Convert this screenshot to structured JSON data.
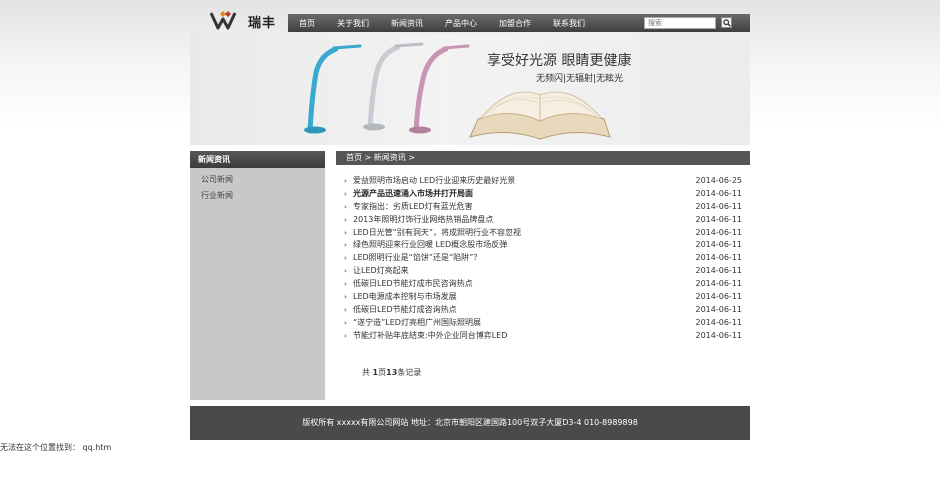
{
  "header": {
    "logo_text": "瑞丰",
    "nav": [
      "首页",
      "关于我们",
      "新闻资讯",
      "产品中心",
      "加盟合作",
      "联系我们"
    ],
    "search_placeholder": "搜索"
  },
  "banner": {
    "title": "享受好光源 眼睛更健康",
    "subtitle": "无频闪|无辐射|无眩光"
  },
  "sidebar": {
    "title": "新闻资讯",
    "items": [
      "公司新闻",
      "行业新闻"
    ]
  },
  "breadcrumb": "首页 > 新闻资讯 >",
  "news": [
    {
      "title": "爱益照明市场启动 LED行业迎来历史最好光景",
      "date": "2014-06-25",
      "bold": false
    },
    {
      "title": "光源产品迅速涌入市场并打开局面",
      "date": "2014-06-11",
      "bold": true
    },
    {
      "title": "专家指出：劣质LED灯有蓝光危害",
      "date": "2014-06-11",
      "bold": false
    },
    {
      "title": "2013年照明灯饰行业网络热销品牌盘点",
      "date": "2014-06-11",
      "bold": false
    },
    {
      "title": "LED日光管“别有洞天”，将成照明行业不容忽视",
      "date": "2014-06-11",
      "bold": false
    },
    {
      "title": "绿色照明迎来行业回暖 LED概念股市场反弹",
      "date": "2014-06-11",
      "bold": false
    },
    {
      "title": "LED照明行业是“馅饼”还是“陷阱”？",
      "date": "2014-06-11",
      "bold": false
    },
    {
      "title": "让LED灯亮起来",
      "date": "2014-06-11",
      "bold": false
    },
    {
      "title": "低碳日LED节能灯成市民咨询热点",
      "date": "2014-06-11",
      "bold": false
    },
    {
      "title": "LED电源成本控制与市场发展",
      "date": "2014-06-11",
      "bold": false
    },
    {
      "title": "低碳日LED节能灯成咨询热点",
      "date": "2014-06-11",
      "bold": false
    },
    {
      "title": "“遂宁造”LED灯亮相广州国际照明展",
      "date": "2014-06-11",
      "bold": false
    },
    {
      "title": "节能灯补贴年底结束:中外企业同台博弈LED",
      "date": "2014-06-11",
      "bold": false
    }
  ],
  "pager": {
    "prefix": "共 ",
    "pages": "1",
    "mid": "页",
    "records": "13",
    "suffix": "条记录"
  },
  "footer": "版权所有 xxxxx有限公司网站 地址：北京市朝阳区建国路100号双子大厦D3-4 010-8989898",
  "error_text": "无法在这个位置找到： qq.htm"
}
